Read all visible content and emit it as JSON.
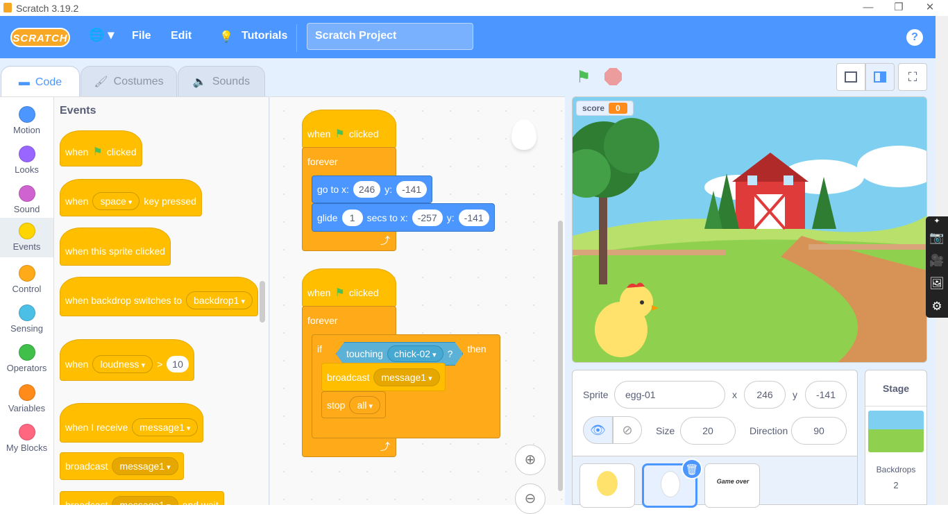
{
  "window": {
    "title": "Scratch 3.19.2",
    "minimize": "—",
    "restore": "❐",
    "close": "✕"
  },
  "menubar": {
    "logo": "SCRATCH",
    "language_icon": "🌐 ▾",
    "file": "File",
    "edit": "Edit",
    "tutorials": "Tutorials",
    "project_title": "Scratch Project",
    "help": "?"
  },
  "tabs": {
    "code": "Code",
    "costumes": "Costumes",
    "sounds": "Sounds"
  },
  "categories": [
    {
      "label": "Motion",
      "color": "#4c97ff"
    },
    {
      "label": "Looks",
      "color": "#9966ff"
    },
    {
      "label": "Sound",
      "color": "#cf63cf"
    },
    {
      "label": "Events",
      "color": "#ffd500"
    },
    {
      "label": "Control",
      "color": "#ffab19"
    },
    {
      "label": "Sensing",
      "color": "#4cbfe6"
    },
    {
      "label": "Operators",
      "color": "#40bf4a"
    },
    {
      "label": "Variables",
      "color": "#ff8c1a"
    },
    {
      "label": "My Blocks",
      "color": "#ff6680"
    }
  ],
  "palette": {
    "heading": "Events",
    "when": "when",
    "clicked": "clicked",
    "space": "space",
    "key_pressed": "key pressed",
    "sprite_clicked": "when this sprite clicked",
    "backdrop_switches": "when backdrop switches to",
    "backdrop1": "backdrop1",
    "loudness": "loudness",
    "gt": ">",
    "loudness_val": "10",
    "when_receive": "when I receive",
    "message1": "message1",
    "broadcast": "broadcast",
    "and_wait": "and wait"
  },
  "script1": {
    "when": "when",
    "clicked": "clicked",
    "forever": "forever",
    "goto": "go to x:",
    "goto_x": "246",
    "y": "y:",
    "goto_y": "-141",
    "glide": "glide",
    "glide_secs": "1",
    "secs_to_x": "secs to x:",
    "glide_x": "-257",
    "glide_y": "-141"
  },
  "script2": {
    "when": "when",
    "clicked": "clicked",
    "forever": "forever",
    "if": "if",
    "touching": "touching",
    "target": "chick-02",
    "q": "?",
    "then": "then",
    "broadcast": "broadcast",
    "message": "message1",
    "stop": "stop",
    "stop_opt": "all"
  },
  "stage": {
    "monitor_label": "score",
    "monitor_value": "0",
    "colors": {
      "sky": "#7fd0f0",
      "grass": "#8fd14f",
      "barn": "#e03b3b"
    }
  },
  "sprite_info": {
    "sprite_label": "Sprite",
    "sprite_name": "egg-01",
    "x_label": "x",
    "x": "246",
    "y_label": "y",
    "y": "-141",
    "size_label": "Size",
    "size": "20",
    "direction_label": "Direction",
    "direction": "90"
  },
  "stage_panel": {
    "title": "Stage",
    "backdrops_label": "Backdrops",
    "backdrops_count": "2"
  },
  "thumbs": {
    "game_over": "Game over"
  }
}
